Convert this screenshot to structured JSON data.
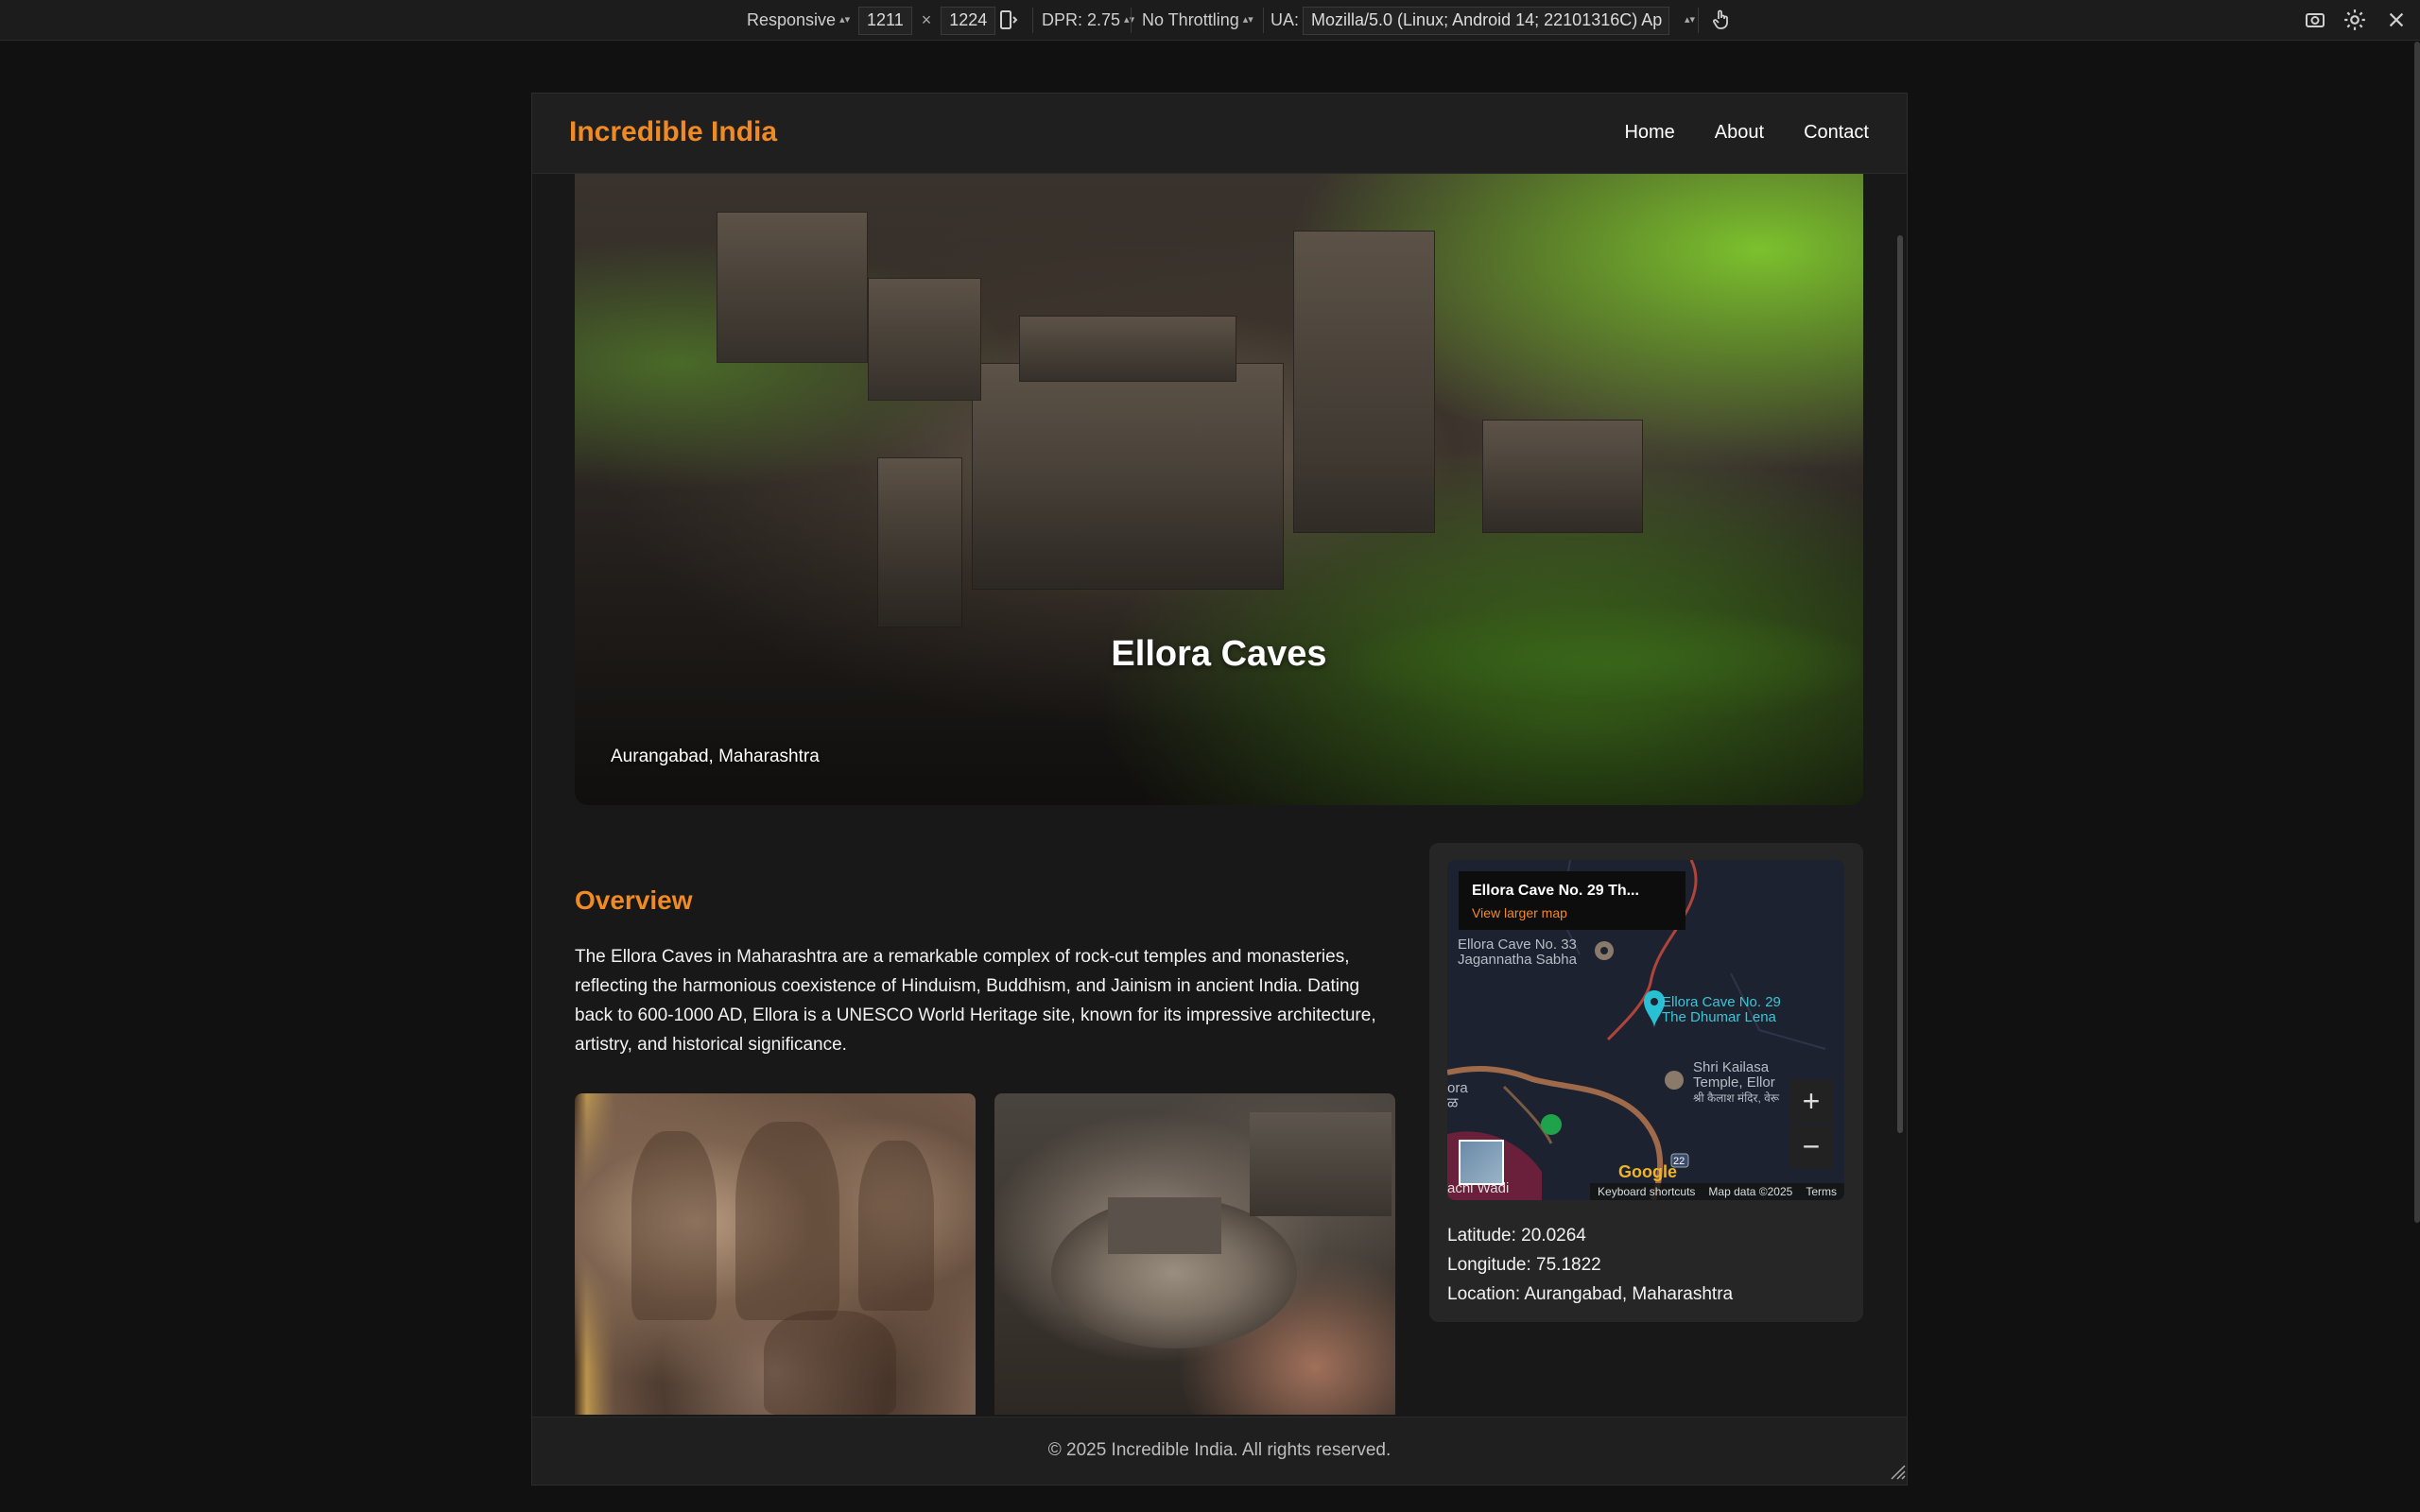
{
  "devtools": {
    "mode": "Responsive",
    "width": "1211",
    "height": "1224",
    "times": "×",
    "dpr": "DPR: 2.75",
    "throttle": "No Throttling",
    "ua_label": "UA:",
    "ua_value": "Mozilla/5.0 (Linux; Android 14; 22101316C) Ap",
    "icons": [
      "rotate-device-icon",
      "touch-icon",
      "screenshot-icon",
      "settings-icon",
      "close-icon"
    ]
  },
  "site": {
    "brand": "Incredible India",
    "nav": [
      {
        "label": "Home"
      },
      {
        "label": "About"
      },
      {
        "label": "Contact"
      }
    ],
    "accent": "#f08a24"
  },
  "hero": {
    "title": "Ellora Caves",
    "subtitle": "Aurangabad, Maharashtra"
  },
  "overview": {
    "heading": "Overview",
    "text": "The Ellora Caves in Maharashtra are a remarkable complex of rock-cut temples and monasteries, reflecting the harmonious coexistence of Hinduism, Buddhism, and Jainism in ancient India. Dating back to 600-1000 AD, Ellora is a UNESCO World Heritage site, known for its impressive architecture, artistry, and historical significance."
  },
  "map": {
    "card_title": "Ellora Cave No. 29 Th...",
    "card_link": "View larger map",
    "labels": {
      "cave33_line1": "Ellora Cave No. 33",
      "cave33_line2": "Jagannatha Sabha",
      "cave29_line1": "Ellora Cave No. 29",
      "cave29_line2": "The Dhumar Lena",
      "kailasa_line1": "Shri Kailasa",
      "kailasa_line2": "Temple, Ellor",
      "kailasa_line3": "श्री कैलाश मंदिर, वेरू",
      "ora": "ora",
      "ora2": "ळ",
      "wadi": "achi Wadi",
      "road": "22"
    },
    "zoom_in": "+",
    "zoom_out": "−",
    "google": "Google",
    "shortcuts": "Keyboard shortcuts",
    "mapdata": "Map data ©2025",
    "terms": "Terms"
  },
  "location": {
    "latitude": "Latitude: 20.0264",
    "longitude": "Longitude: 75.1822",
    "location": "Location: Aurangabad, Maharashtra"
  },
  "footer": {
    "text": "© 2025 Incredible India. All rights reserved."
  }
}
